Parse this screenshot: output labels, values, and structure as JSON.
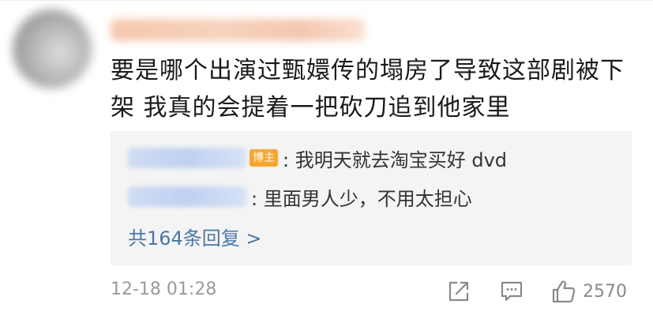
{
  "comment": {
    "username": "",
    "text_line1": "要是哪个出演过甄嬛传的塌房了导致这部剧被下",
    "text_line2": "架 我真的会提着一把砍刀追到他家里",
    "timestamp": "12-18 01:28",
    "like_count": "2570"
  },
  "replies": {
    "items": [
      {
        "name": "",
        "badge": "博主",
        "text": ": 我明天就去淘宝买好 dvd"
      },
      {
        "name": "",
        "badge": "",
        "text": ": 里面男人少，不用太担心"
      }
    ],
    "view_all_label": "共164条回复 >"
  },
  "icons": {
    "share": "share-icon",
    "comment": "comment-icon",
    "like": "thumbs-up-icon"
  },
  "colors": {
    "link": "#4b76a8",
    "badge": "#f4a52b",
    "reply_bg": "#f4f4f4"
  }
}
